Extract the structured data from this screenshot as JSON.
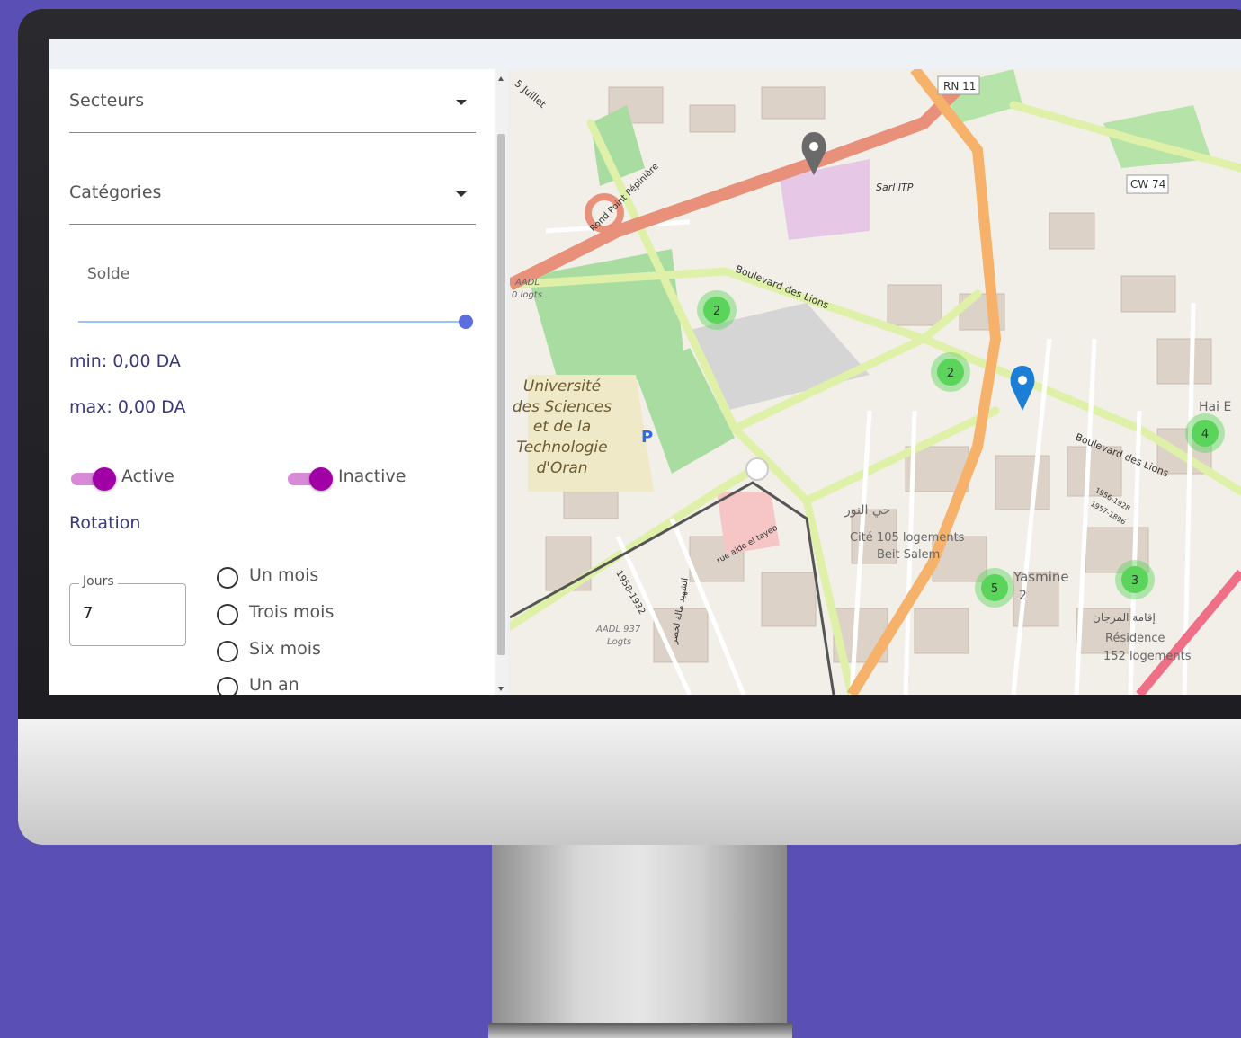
{
  "filters": {
    "sector_label": "Secteurs",
    "category_label": "Catégories",
    "solde_label": "Solde",
    "solde_range": [
      0,
      1
    ],
    "solde_value": 1,
    "min_text": "min: 0,00 DA",
    "max_text": "max: 0,00 DA"
  },
  "toggles": [
    {
      "label": "Active",
      "on": true
    },
    {
      "label": "Inactive",
      "on": true
    }
  ],
  "rotation": {
    "title": "Rotation",
    "jours_label": "Jours",
    "jours_value": "7",
    "options": [
      "Un mois",
      "Trois mois",
      "Six mois",
      "Un an"
    ]
  },
  "map": {
    "labels": {
      "rn11": "RN 11",
      "cw74": "CW 74",
      "sarl": "Sarl ITP",
      "rond_point": "Rond Point Pépinière",
      "juillet": "5 Juillet",
      "aadl": "AADL",
      "logts": "0 logts",
      "boulevard1": "Boulevard des Lions",
      "boulevard2": "Boulevard des Lions",
      "univ1": "Université",
      "univ2": "des Sciences",
      "univ3": "et de la",
      "univ4": "Technologie",
      "univ5": "d'Oran",
      "parking": "P",
      "hai": "Hai E",
      "nour": "حي النور",
      "cite1": "Cité 105 logements",
      "cite2": "Beit Salem",
      "yasmine": "Yasmine",
      "yasmine2": "2",
      "residence1": "Résidence",
      "residence2": "152 logements",
      "marjane": "إقامة المرجان",
      "rue_aide": "rue aide el tayeb",
      "year": "1958-1932",
      "aadl937": "AADL 937",
      "aadl937b": "Logts",
      "chahid": "الشهيد مالة لخضر",
      "date_a": "1956-1928",
      "date_b": "1957-1896"
    },
    "clusters": [
      {
        "id": "c1",
        "count": "2"
      },
      {
        "id": "c2",
        "count": "2"
      },
      {
        "id": "c3",
        "count": "4"
      },
      {
        "id": "c4",
        "count": "5"
      },
      {
        "id": "c5",
        "count": "3"
      }
    ],
    "colors": {
      "primary_road": "#e8907a",
      "trunk_road": "#f6b16a",
      "secondary_road": "#dff0a8",
      "park": "#a8dca0",
      "campus": "#f0e9c8",
      "cluster": "#5ad45a",
      "marker_blue": "#1d7ed6",
      "marker_gray": "#6a6a6a"
    }
  },
  "colors": {
    "background": "#5a4fb4",
    "toggle_on": "#a000a6",
    "slider": "#5b6ee0",
    "text_accent": "#3a3a7a"
  }
}
